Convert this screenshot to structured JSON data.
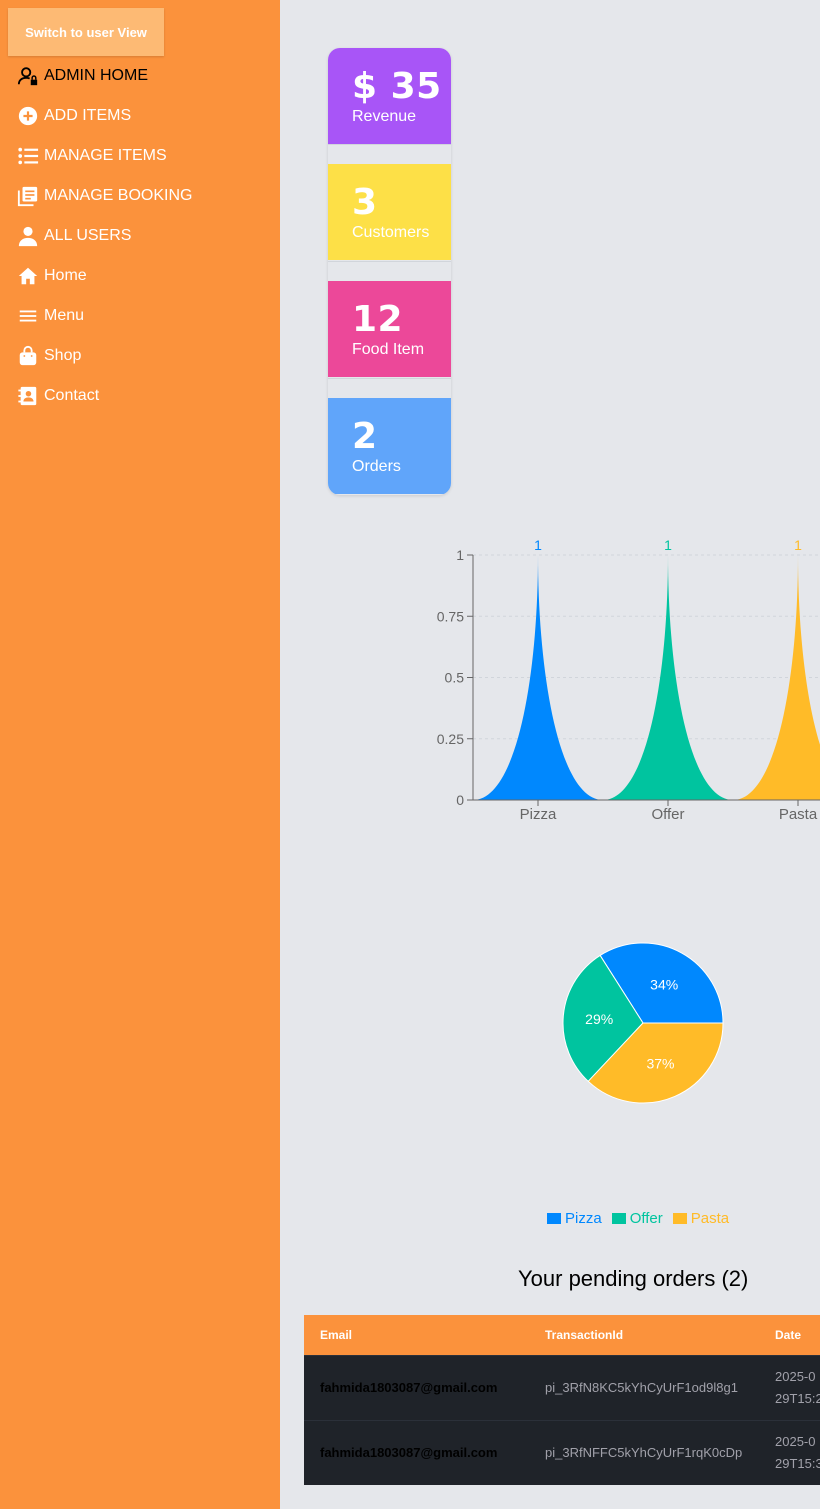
{
  "sidebar": {
    "switch_label": "Switch to user View",
    "items": [
      {
        "label": "ADMIN HOME",
        "icon": "user-lock-icon"
      },
      {
        "label": "ADD ITEMS",
        "icon": "plus-circle-icon"
      },
      {
        "label": "MANAGE ITEMS",
        "icon": "list-icon"
      },
      {
        "label": "MANAGE BOOKING",
        "icon": "book-icon"
      },
      {
        "label": "ALL USERS",
        "icon": "user-icon"
      },
      {
        "label": "Home",
        "icon": "home-icon"
      },
      {
        "label": "Menu",
        "icon": "menu-icon"
      },
      {
        "label": "Shop",
        "icon": "shopping-bag-icon"
      },
      {
        "label": "Contact",
        "icon": "contact-book-icon"
      }
    ]
  },
  "stats": [
    {
      "value": "$ 35",
      "label": "Revenue",
      "color": "#a855f7"
    },
    {
      "value": "3",
      "label": "Customers",
      "color": "#fde047"
    },
    {
      "value": "12",
      "label": "Food Item",
      "color": "#ec4899"
    },
    {
      "value": "2",
      "label": "Orders",
      "color": "#60a5fa"
    }
  ],
  "chart_data": [
    {
      "type": "area",
      "categories": [
        "Pizza",
        "Offer",
        "Pasta"
      ],
      "values": [
        1,
        1,
        1
      ],
      "data_labels": [
        "1",
        "1",
        "1"
      ],
      "colors": [
        "#0088fe",
        "#00c49f",
        "#ffbb28"
      ],
      "yticks": [
        "0",
        "0.25",
        "0.5",
        "0.75",
        "1"
      ],
      "ylim": [
        0,
        1
      ],
      "grid": true
    },
    {
      "type": "pie",
      "slices": [
        {
          "name": "Pizza",
          "value": 34,
          "label": "34%",
          "color": "#0088fe"
        },
        {
          "name": "Offer",
          "value": 29,
          "label": "29%",
          "color": "#00c49f"
        },
        {
          "name": "Pasta",
          "value": 37,
          "label": "37%",
          "color": "#ffbb28"
        }
      ],
      "legend": [
        "Pizza",
        "Offer",
        "Pasta"
      ],
      "legend_position": "bottom"
    }
  ],
  "orders": {
    "title": "Your pending orders (2)",
    "columns": [
      "Email",
      "TransactionId",
      "Date"
    ],
    "rows": [
      {
        "email": "fahmida1803087@gmail.com",
        "transaction": "pi_3RfN8KC5kYhCyUrF1od9l8g1",
        "date_line1": "2025-0",
        "date_line2": "29T15:2"
      },
      {
        "email": "fahmida1803087@gmail.com",
        "transaction": "pi_3RfNFFC5kYhCyUrF1rqK0cDp",
        "date_line1": "2025-0",
        "date_line2": "29T15:3"
      }
    ]
  }
}
